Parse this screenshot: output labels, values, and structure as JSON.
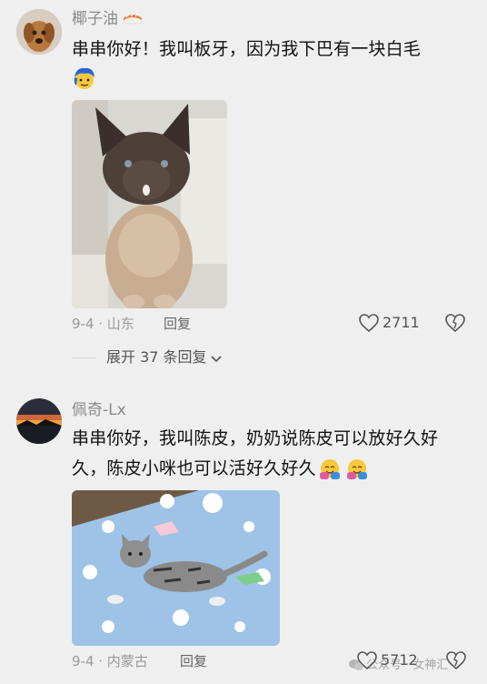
{
  "comments": [
    {
      "username": "椰子油",
      "username_emoji": "sushi-emoji",
      "text": "串串你好！我叫板牙，因为我下巴有一块白毛",
      "inline_emoji": "blue-hair-face-emoji",
      "meta": "9-4 · 山东",
      "reply_label": "回复",
      "likes": "2711",
      "expand_label": "展开 37 条回复"
    },
    {
      "username": "佩奇-Lx",
      "text_line1": "串串你好，我叫陈皮，奶奶说陈皮可以放好久好",
      "text_line2": "久，陈皮小咪也可以活好久好久",
      "inline_emojis": [
        "hugging-face-emoji",
        "hugging-face-emoji"
      ],
      "meta": "9-4 · 内蒙古",
      "reply_label": "回复",
      "likes": "5712"
    }
  ],
  "watermark": "公众号 · 女神汇",
  "colors": {
    "background": "#efefef",
    "meta_gray": "#9a9a9a",
    "text": "#111111"
  }
}
